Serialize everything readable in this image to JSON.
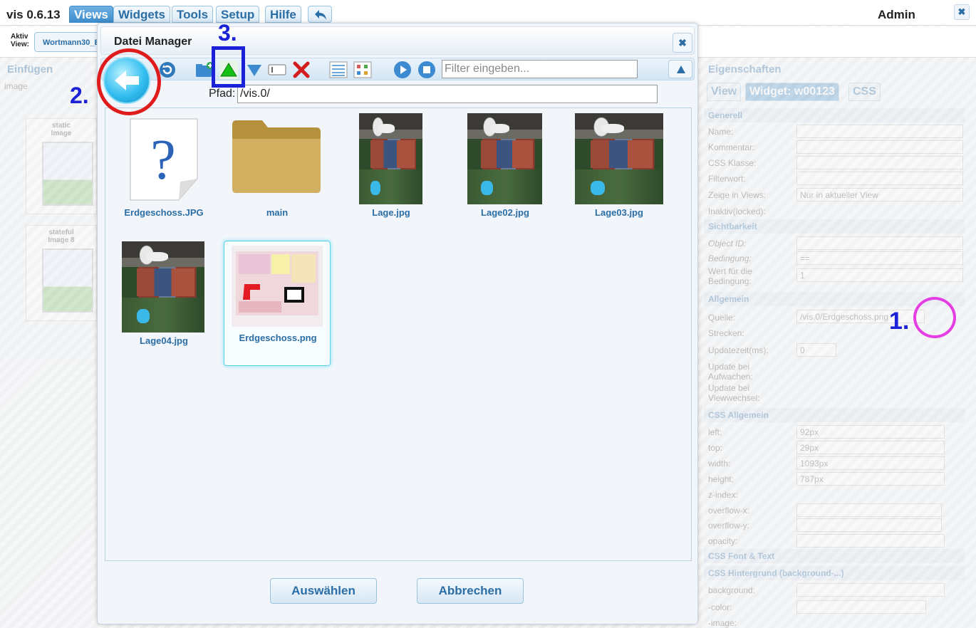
{
  "app": {
    "title": "vis 0.6.13",
    "menu": [
      "Views",
      "Widgets",
      "Tools",
      "Setup",
      "Hilfe"
    ],
    "active_menu": "Views",
    "user": "Admin",
    "close_glyph": "✖"
  },
  "view_row": {
    "label_line1": "Aktiv",
    "label_line2": "View:",
    "current_view": "Wortmann30_E"
  },
  "left_panel": {
    "title": "Einfügen",
    "filter": "image",
    "widgets": [
      {
        "line1": "static",
        "line2": "Image"
      },
      {
        "line1": "stateful",
        "line2": "Image 8"
      }
    ]
  },
  "right_panel": {
    "title": "Eigenschaften",
    "tabs": [
      "View",
      "Widget: w00123",
      "CSS"
    ],
    "sections": {
      "generell": "Generell",
      "sichtbarkeit": "Sichtbarkeit",
      "allgemein": "Allgemein",
      "css_allgemein": "CSS Allgemein",
      "css_font": "CSS Font & Text",
      "css_bg": "CSS Hintergrund (background-...)"
    },
    "fields": {
      "name": "Name:",
      "kommentar": "Kommentar:",
      "css_klasse": "CSS Klasse:",
      "filterwort": "Filterwort:",
      "zeige": "Zeige in Views:",
      "zeige_value": "Nur in aktueller View",
      "inaktiv": "Inaktiv(locked):",
      "object_id": "Object ID:",
      "bedingung": "Bedingung:",
      "bedingung_value": "==",
      "wert_line1": "Wert für die",
      "wert_line2": "Bedingung:",
      "wert_value": "1",
      "quelle": "Quelle:",
      "quelle_value": "/vis.0/Erdgeschoss.png",
      "strecken": "Strecken:",
      "updatezeit": "Updatezeit(ms):",
      "updatezeit_value": "0",
      "update_aufwachen_1": "Update bei",
      "update_aufwachen_2": "Aufwachen:",
      "update_view_1": "Update bei",
      "update_view_2": "Viewwechsel:",
      "left": "left:",
      "left_value": "92px",
      "top": "top:",
      "top_value": "29px",
      "width": "width:",
      "width_value": "1093px",
      "height": "height:",
      "height_value": "787px",
      "zindex": "z-index:",
      "overflow_x": "overflow-x:",
      "overflow_y": "overflow-y:",
      "opacity": "opacity:",
      "background": "background:",
      "color": "-color:",
      "image": "-image:"
    }
  },
  "dialog": {
    "title": "Datei Manager",
    "filter_placeholder": "Filter eingeben...",
    "path_label": "Pfad:",
    "path_value": "/vis.0/",
    "files": [
      {
        "name": "Erdgeschoss.JPG",
        "kind": "unknown-file-icon"
      },
      {
        "name": "main",
        "kind": "folder-icon"
      },
      {
        "name": "Lage.jpg",
        "kind": "aerial-photo"
      },
      {
        "name": "Lage02.jpg",
        "kind": "aerial-photo"
      },
      {
        "name": "Lage03.jpg",
        "kind": "aerial-photo"
      },
      {
        "name": "Lage04.jpg",
        "kind": "aerial-photo"
      },
      {
        "name": "Erdgeschoss.png",
        "kind": "floor-plan",
        "selected": true
      }
    ],
    "select_button": "Auswählen",
    "cancel_button": "Abbrechen"
  },
  "annotations": {
    "one": "1.",
    "two": "2.",
    "three": "3."
  },
  "colors": {
    "accent": "#2b6ea6",
    "annotation_blue": "#1a21d6",
    "annotation_red": "#e01b1b",
    "annotation_magenta": "#e43ee4",
    "selection_glow": "#59d0ee"
  }
}
